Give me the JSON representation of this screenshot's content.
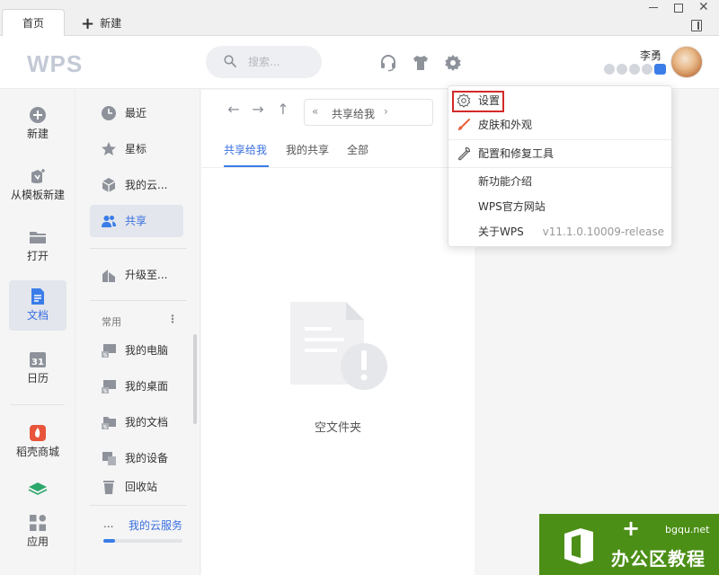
{
  "tabs": {
    "home": "首页",
    "new_tab": "新建"
  },
  "header": {
    "logo": "WPS",
    "search_placeholder": "搜索...",
    "user_name": "李勇"
  },
  "left_nav": [
    {
      "label": "新建"
    },
    {
      "label": "从模板新建"
    },
    {
      "label": "打开"
    },
    {
      "label": "文档"
    },
    {
      "label": "日历"
    },
    {
      "label": "稻壳商城"
    },
    {
      "label": "应用"
    }
  ],
  "second_nav": {
    "items": [
      {
        "label": "最近"
      },
      {
        "label": "星标"
      },
      {
        "label": "我的云..."
      },
      {
        "label": "共享"
      },
      {
        "label": "升级至..."
      }
    ],
    "section_title": "常用",
    "section_more": "⋮",
    "locations": [
      {
        "label": "我的电脑"
      },
      {
        "label": "我的桌面"
      },
      {
        "label": "我的文档"
      },
      {
        "label": "我的设备"
      },
      {
        "label": "回收站"
      }
    ],
    "quota_dots": "...",
    "quota_label": "我的云服务",
    "quota_fill": 0.15
  },
  "main": {
    "path_text": "共享给我",
    "tabs": [
      "共享给我",
      "我的共享",
      "全部"
    ],
    "active_tab": 0,
    "empty_text": "空文件夹"
  },
  "menu": {
    "items": [
      {
        "label": "设置",
        "icon": "gear-icon"
      },
      {
        "label": "皮肤和外观",
        "icon": "brush-icon"
      },
      {
        "label": "配置和修复工具",
        "icon": "wrench-icon"
      },
      {
        "label": "新功能介绍"
      },
      {
        "label": "WPS官方网站"
      },
      {
        "label": "关于WPS"
      }
    ],
    "version": "v11.1.0.10009-release"
  },
  "watermark": {
    "domain": "bgqu.net",
    "title": "办公区教程"
  },
  "colors": {
    "accent": "#3a7de8",
    "highlight": "#d42a2a",
    "watermark_bg": "#4c8f16"
  }
}
